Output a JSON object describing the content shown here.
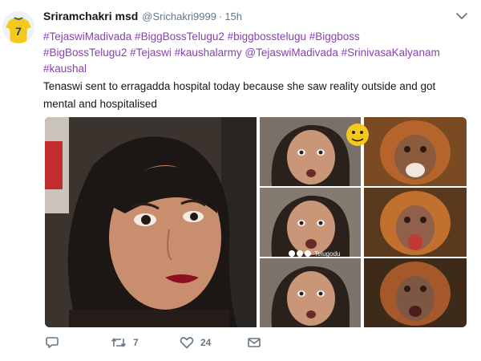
{
  "user": {
    "name": "Sriramchakri msd",
    "handle": "@Srichakri9999",
    "separator": "·",
    "time": "15h",
    "avatar_jersey_number": "7"
  },
  "tweet": {
    "tag_lines": [
      "#TejaswiMadivada #BiggBossTelugu2 #biggbosstelugu #Biggboss",
      "#BigBossTelugu2 #Tejaswi #kaushalarmy @TejaswiMadivada #SrinivasaKalyanam",
      "#kaushal"
    ],
    "body_line1": "Tenaswi sent to erragadda hospital today because she saw reality outside and got",
    "body_line2": "mental and hospitalised"
  },
  "media": {
    "watermark": "Telugodu"
  },
  "actions": {
    "reply_count": "",
    "retweet_count": "7",
    "like_count": "24"
  },
  "colors": {
    "hashtag": "#8a3fb5",
    "secondary": "#657786",
    "text": "#14171a"
  }
}
